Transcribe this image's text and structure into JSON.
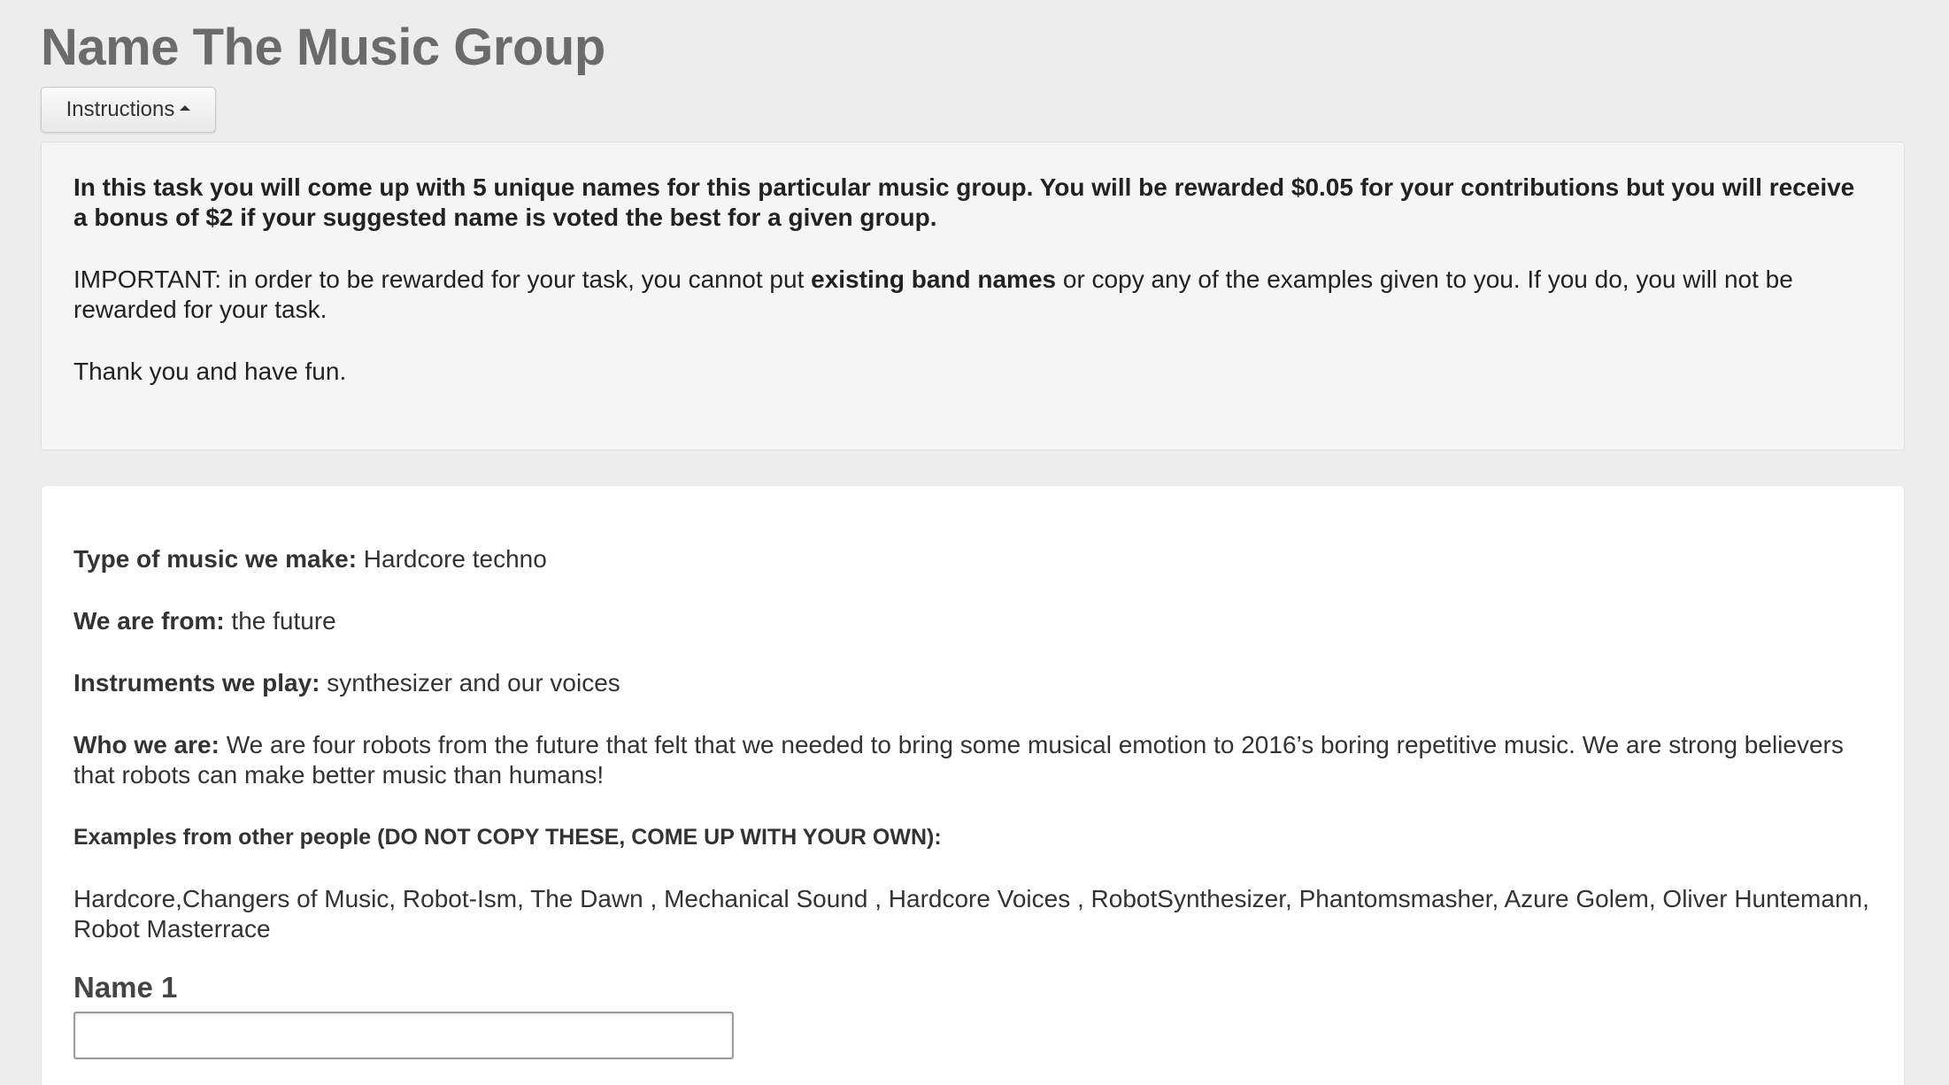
{
  "title": "Name The Music Group",
  "instructions_button": {
    "label": "Instructions",
    "icon": "caret-up-icon"
  },
  "instructions": {
    "paragraph1": "In this task you will come up with 5 unique names for this particular music group. You will be rewarded $0.05 for your contributions but you will receive a bonus of $2 if your suggested name is voted the best for a given group.",
    "paragraph2_before": "IMPORTANT: in order to be rewarded for your task, you cannot put ",
    "paragraph2_bold": "existing band names",
    "paragraph2_after": " or copy any of the examples given to you. If you do, you will not be rewarded for your task.",
    "paragraph3": "Thank you and have fun."
  },
  "band": {
    "type_label": "Type of music we make:",
    "type_value": " Hardcore techno",
    "from_label": "We are from:",
    "from_value": " the future",
    "instruments_label": "Instruments we play:",
    "instruments_value": " synthesizer and our voices",
    "who_label": "Who we are:",
    "who_value": " We are four robots from the future that felt that we needed to bring some musical emotion to 2016’s boring repetitive music. We are strong believers that robots can make better music than humans!"
  },
  "examples": {
    "heading": "Examples from other people (DO NOT COPY THESE, COME UP WITH YOUR OWN):",
    "list": "Hardcore,Changers of Music, Robot-Ism, The Dawn , Mechanical Sound , Hardcore Voices , RobotSynthesizer, Phantomsmasher, Azure Golem, Oliver Huntemann, Robot Masterrace"
  },
  "form": {
    "name1_label": "Name 1",
    "name1_value": ""
  }
}
